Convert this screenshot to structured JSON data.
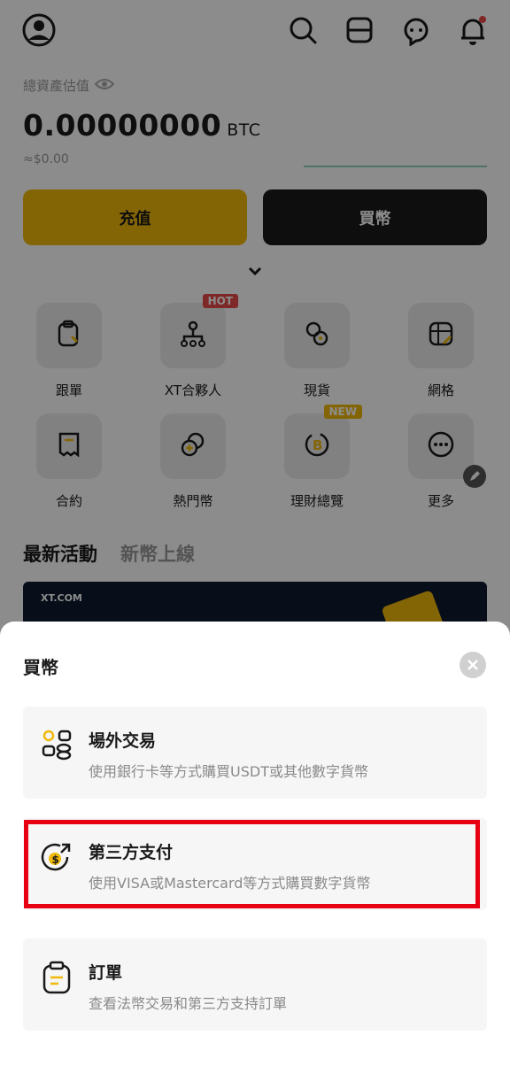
{
  "header": {
    "asset_label": "總資產估值",
    "balance_value": "0.00000000",
    "balance_unit": "BTC",
    "fiat_value": "≈$0.00"
  },
  "actions": {
    "deposit_label": "充值",
    "buy_label": "買幣"
  },
  "grid": [
    {
      "label": "跟單",
      "icon": "copy-trade-icon",
      "badge": ""
    },
    {
      "label": "XT合夥人",
      "icon": "partner-icon",
      "badge": "HOT"
    },
    {
      "label": "現貨",
      "icon": "spot-icon",
      "badge": ""
    },
    {
      "label": "網格",
      "icon": "grid-icon",
      "badge": ""
    },
    {
      "label": "合約",
      "icon": "futures-icon",
      "badge": ""
    },
    {
      "label": "熱門幣",
      "icon": "hot-coin-icon",
      "badge": ""
    },
    {
      "label": "理財總覽",
      "icon": "earn-icon",
      "badge": "NEW"
    },
    {
      "label": "更多",
      "icon": "more-icon",
      "badge": ""
    }
  ],
  "tabs": {
    "active": "最新活動",
    "inactive": "新幣上線"
  },
  "banner": {
    "brand": "XT.COM"
  },
  "sheet": {
    "title": "買幣",
    "options": [
      {
        "title": "場外交易",
        "desc": "使用銀行卡等方式購買USDT或其他數字貨幣",
        "icon": "otc-icon"
      },
      {
        "title": "第三方支付",
        "desc": "使用VISA或Mastercard等方式購買數字貨幣",
        "icon": "third-party-pay-icon"
      },
      {
        "title": "訂單",
        "desc": "查看法幣交易和第三方支持訂單",
        "icon": "orders-icon"
      }
    ]
  },
  "colors": {
    "accent": "#f0b90b",
    "highlight": "#e60012",
    "hot_badge": "#e84a4a",
    "new_badge": "#f0b90b"
  }
}
